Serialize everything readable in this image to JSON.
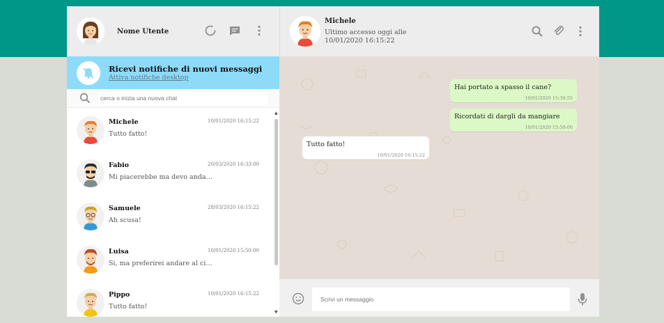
{
  "user": {
    "name": "Nome Utente"
  },
  "notification": {
    "title": "Ricevi notifiche di nuovi messaggi",
    "link": "Attiva notifiche desktop"
  },
  "search": {
    "placeholder": "cerca o inizia una nuova chat"
  },
  "chats": [
    {
      "name": "Michele",
      "message": "Tutto fatto!",
      "time": "10/01/2020 16:15:22"
    },
    {
      "name": "Fabio",
      "message": "Mi piacerebbe ma devo andare a fare la spesa.",
      "time": "20/03/2020 16:33:00"
    },
    {
      "name": "Samuele",
      "message": "Ah scusa!",
      "time": "28/03/2020 16:15:22"
    },
    {
      "name": "Luisa",
      "message": "Si, ma preferirei andare al cinema",
      "time": "10/01/2020 15:50:00"
    },
    {
      "name": "Pippo",
      "message": "Tutto fatto!",
      "time": "10/01/2020 16:15:22"
    }
  ],
  "conversation": {
    "contact": "Michele",
    "last_seen": "Ultimo accesso oggi alle 10/01/2020 16:15:22",
    "messages": [
      {
        "text": "Hai portato a spasso il cane?",
        "time": "10/01/2020 15:30:55",
        "direction": "sent"
      },
      {
        "text": "Ricordati di dargli da mangiare",
        "time": "10/01/2020 15:50:00",
        "direction": "sent"
      },
      {
        "text": "Tutto fatto!",
        "time": "10/01/2020 16:15:22",
        "direction": "received"
      }
    ]
  },
  "composer": {
    "placeholder": "Scrivi un messaggio"
  },
  "colors": {
    "brand": "#009688",
    "notification": "#8edbf9",
    "sent_bubble": "#dcf8c6",
    "chat_bg": "#e5ddd5"
  }
}
